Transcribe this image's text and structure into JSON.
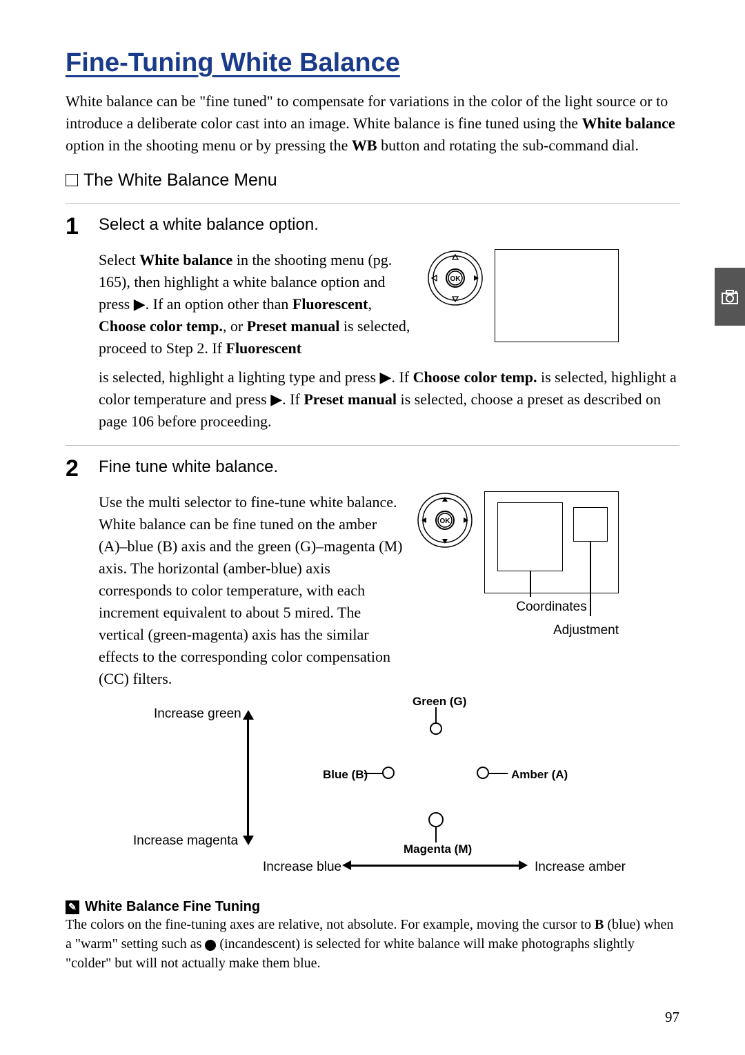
{
  "title": "Fine-Tuning White Balance",
  "intro": {
    "p1a": "White balance can be \"fine tuned\" to compensate for variations in the color of the light source or to introduce a deliberate color cast into an image.  White balance is fine tuned using the ",
    "p1b": "White balance",
    "p1c": " option in the shooting menu or by pressing the ",
    "p1d": "WB",
    "p1e": " button and rotating the sub-command dial."
  },
  "section1": {
    "heading": "The White Balance Menu"
  },
  "step1": {
    "num": "1",
    "title": "Select a white balance option.",
    "t1": "Select ",
    "t2": "White balance",
    "t3": " in the shooting menu (pg. 165), then highlight a white balance option and press ",
    "t4": ".  If an option other than ",
    "t5": "Fluorescent",
    "t6": ", ",
    "t7": "Choose color temp.",
    "t8": ", or ",
    "t9": "Preset manual",
    "t10": " is selected, proceed to Step 2.  If ",
    "t11": "Fluorescent",
    "t12": " is selected, highlight a lighting type and press ",
    "t13": ".  If ",
    "t14": "Choose color temp.",
    "t15": " is selected, highlight a color temperature and press ",
    "t16": ".  If ",
    "t17": "Preset manual",
    "t18": " is selected, choose a preset as described on page 106 before proceeding."
  },
  "step2": {
    "num": "2",
    "title": "Fine tune white balance.",
    "body": "Use the multi selector to fine-tune white balance.  White balance can be fine tuned on the amber (A)–blue (B) axis and the green (G)–magenta (M) axis.  The horizontal (amber-blue) axis corresponds to color temperature, with each increment equivalent to about 5 mired.  The vertical (green-magenta) axis has the similar effects to the corresponding color compensation (CC) filters.",
    "coords_label": "Coordinates",
    "adjust_label": "Adjustment"
  },
  "diagram": {
    "inc_green": "Increase green",
    "inc_magenta": "Increase magenta",
    "inc_blue": "Increase blue",
    "inc_amber": "Increase amber",
    "green": "Green (G)",
    "blue": "Blue (B)",
    "amber": "Amber (A)",
    "magenta": "Magenta (M)"
  },
  "note": {
    "heading": "White Balance Fine Tuning",
    "t1": "The colors on the fine-tuning axes are relative, not absolute.  For example, moving the cursor to ",
    "t2": "B",
    "t3": " (blue) when a \"warm\" setting such as ",
    "t4": " (incandescent) is selected for white balance will make photographs slightly \"colder\" but will not actually make them blue."
  },
  "page_number": "97"
}
